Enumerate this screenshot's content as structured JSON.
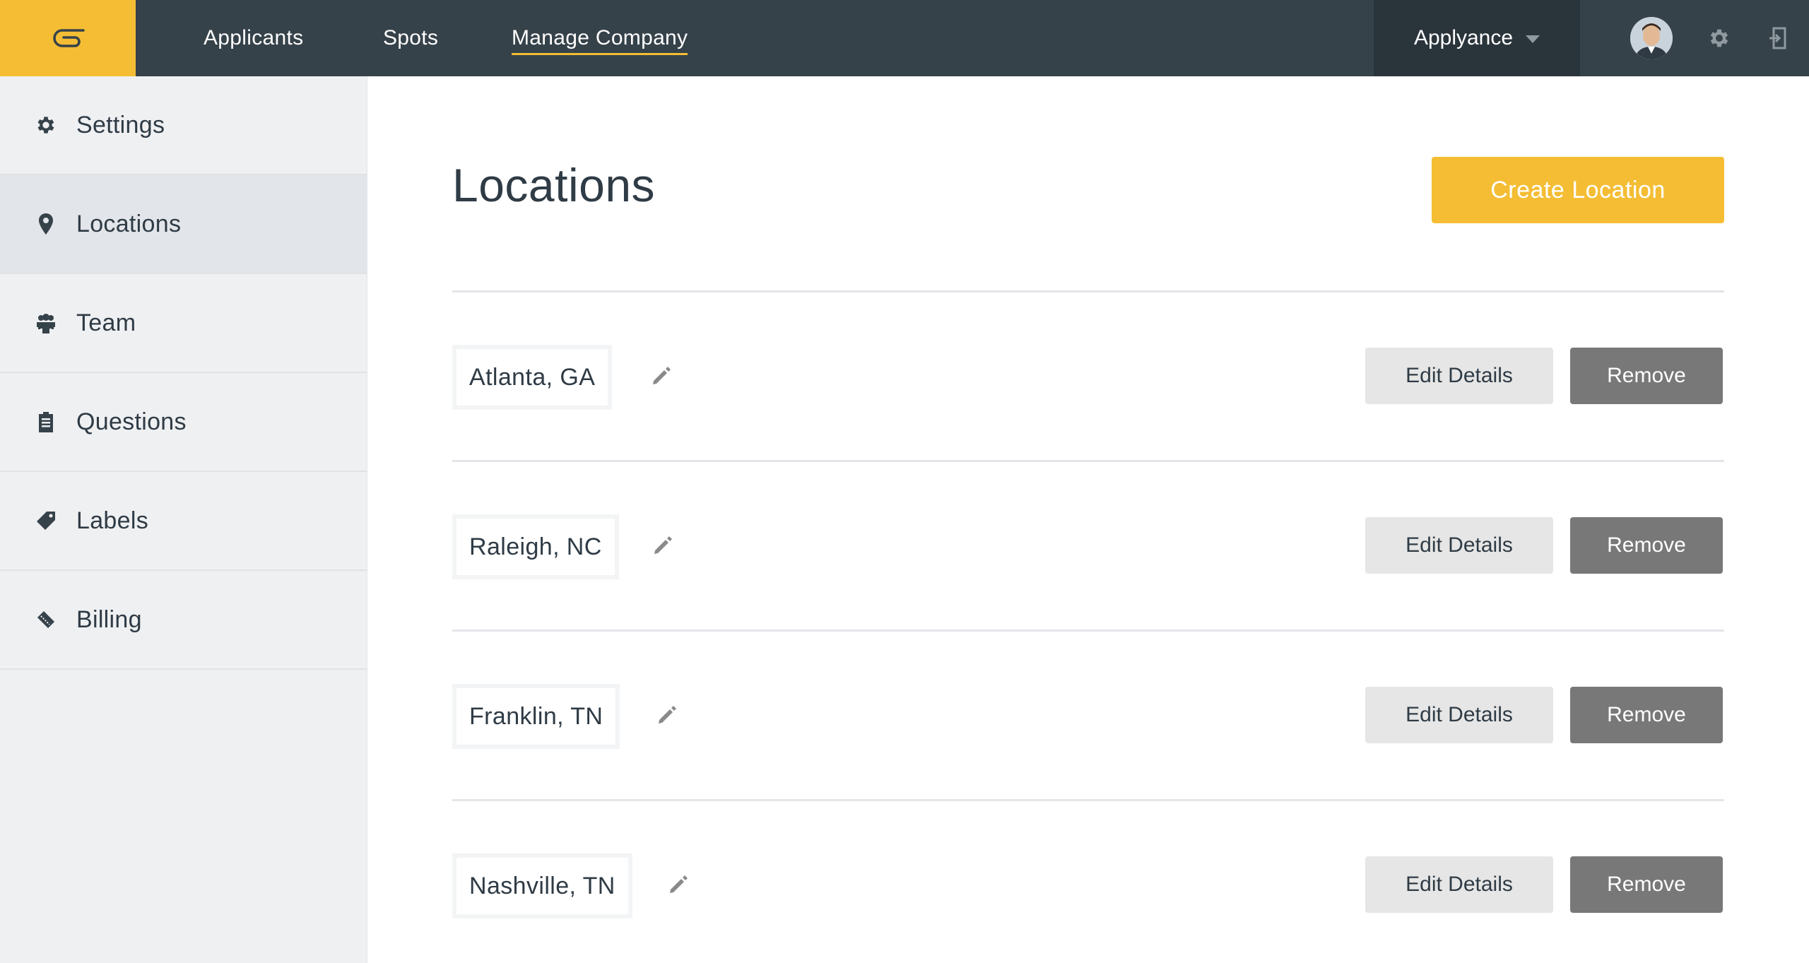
{
  "topbar": {
    "nav": [
      {
        "label": "Applicants"
      },
      {
        "label": "Spots"
      },
      {
        "label": "Manage Company",
        "active": true
      }
    ],
    "company": "Applyance",
    "brand_color": "#f4bd34"
  },
  "sidebar": {
    "items": [
      {
        "label": "Settings",
        "icon": "gear-icon"
      },
      {
        "label": "Locations",
        "icon": "map-pin-icon",
        "active": true
      },
      {
        "label": "Team",
        "icon": "team-icon"
      },
      {
        "label": "Questions",
        "icon": "clipboard-icon"
      },
      {
        "label": "Labels",
        "icon": "tag-icon"
      },
      {
        "label": "Billing",
        "icon": "ticket-icon"
      }
    ]
  },
  "main": {
    "title": "Locations",
    "create_button": "Create Location",
    "locations": [
      {
        "name": "Atlanta, GA",
        "edit_label": "Edit Details",
        "remove_label": "Remove"
      },
      {
        "name": "Raleigh, NC",
        "edit_label": "Edit Details",
        "remove_label": "Remove"
      },
      {
        "name": "Franklin, TN",
        "edit_label": "Edit Details",
        "remove_label": "Remove"
      },
      {
        "name": "Nashville, TN",
        "edit_label": "Edit Details",
        "remove_label": "Remove"
      }
    ]
  }
}
